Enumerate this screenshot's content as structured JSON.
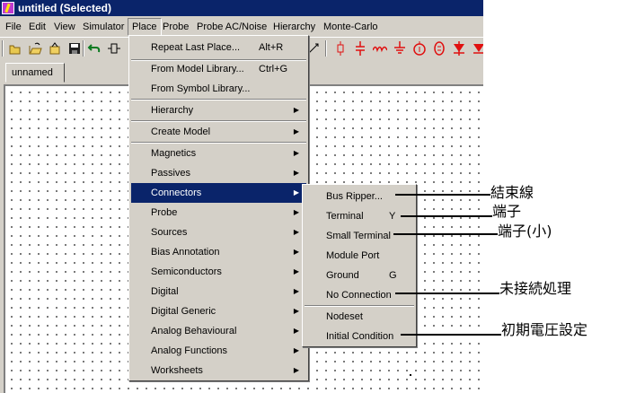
{
  "window": {
    "title": "untitled (Selected)"
  },
  "menubar": [
    {
      "label": "File"
    },
    {
      "label": "Edit"
    },
    {
      "label": "View"
    },
    {
      "label": "Simulator"
    },
    {
      "label": "Place"
    },
    {
      "label": "Probe"
    },
    {
      "label": "Probe AC/Noise"
    },
    {
      "label": "Hierarchy"
    },
    {
      "label": "Monte-Carlo"
    }
  ],
  "tabs": [
    {
      "label": "unnamed"
    }
  ],
  "toolbar_icons": [
    "new-file-icon",
    "open-folder-icon",
    "open-file-icon",
    "save-icon",
    "undo-icon",
    "component-icon",
    "wire-icon",
    "resistor-icon",
    "capacitor-icon",
    "inductor-icon",
    "ground-symbol-icon",
    "current-source-icon",
    "voltage-source-icon",
    "diode-icon",
    "diode-icon-2"
  ],
  "colors": {
    "titlebar": "#0a246a",
    "highlight": "#0a246a",
    "face": "#d4d0c8",
    "toolbar_symbols": "#e01010"
  },
  "place_menu": {
    "items": [
      {
        "label": "Repeat Last Place...",
        "shortcut": "Alt+R"
      },
      {
        "label": "From Model Library...",
        "shortcut": "Ctrl+G"
      },
      {
        "label": "From Symbol Library..."
      },
      {
        "label": "Hierarchy"
      },
      {
        "label": "Create Model"
      },
      {
        "label": "Magnetics"
      },
      {
        "label": "Passives"
      },
      {
        "label": "Connectors"
      },
      {
        "label": "Probe"
      },
      {
        "label": "Sources"
      },
      {
        "label": "Bias Annotation"
      },
      {
        "label": "Semiconductors"
      },
      {
        "label": "Digital"
      },
      {
        "label": "Digital Generic"
      },
      {
        "label": "Analog Behavioural"
      },
      {
        "label": "Analog Functions"
      },
      {
        "label": "Worksheets"
      }
    ]
  },
  "connectors_menu": {
    "items": [
      {
        "label": "Bus Ripper..."
      },
      {
        "label": "Terminal",
        "shortcut": "Y"
      },
      {
        "label": "Small Terminal"
      },
      {
        "label": "Module Port"
      },
      {
        "label": "Ground",
        "shortcut": "G"
      },
      {
        "label": "No Connection"
      },
      {
        "label": "Nodeset"
      },
      {
        "label": "Initial Condition"
      }
    ]
  },
  "annotations": [
    {
      "text": "結束線"
    },
    {
      "text": "端子"
    },
    {
      "text": "端子(小)"
    },
    {
      "text": "未接続処理"
    },
    {
      "text": "初期電圧設定"
    }
  ]
}
